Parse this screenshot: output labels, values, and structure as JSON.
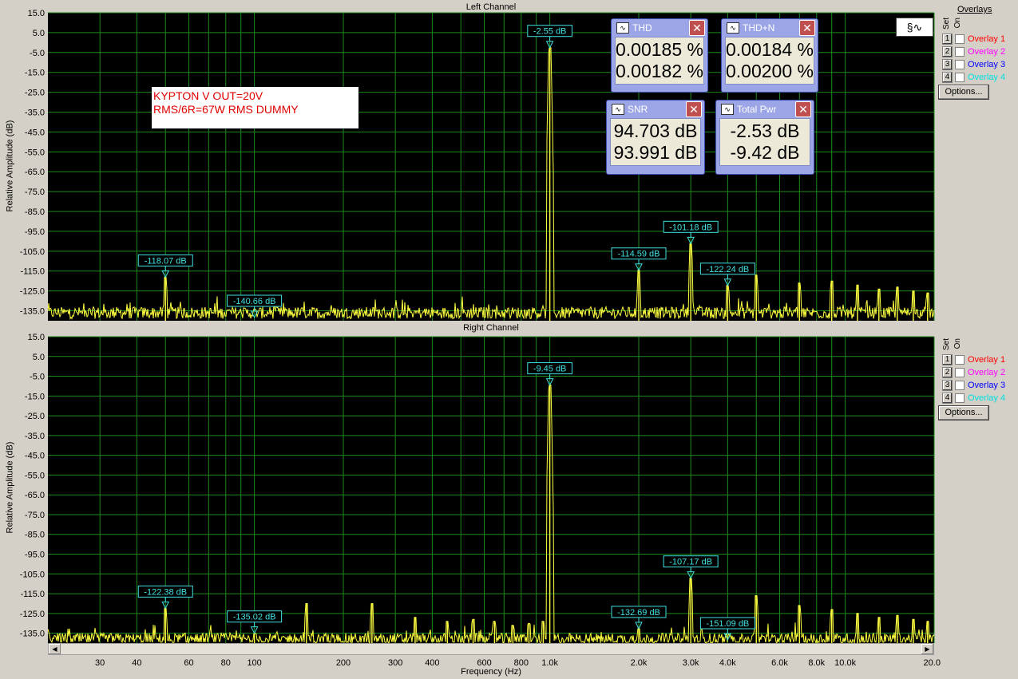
{
  "left_title": "Left Channel",
  "right_title": "Right Channel",
  "ylabel": "Relative Amplitude (dB)",
  "xlabel": "Frequency (Hz)",
  "note_lines": [
    "KYPTON V OUT=20V",
    "RMS/6R=67W RMS DUMMY"
  ],
  "overlays_header": "Overlays",
  "set_label": "Set",
  "on_label": "On",
  "overlays": [
    {
      "num": "1",
      "label": "Overlay 1",
      "color": "#ff0000"
    },
    {
      "num": "2",
      "label": "Overlay 2",
      "color": "#ff00ff"
    },
    {
      "num": "3",
      "label": "Overlay 3",
      "color": "#0000ff"
    },
    {
      "num": "4",
      "label": "Overlay 4",
      "color": "#00ffff"
    }
  ],
  "options_label": "Options...",
  "meters": {
    "thd": {
      "title": "THD",
      "v1": "0.00185 %",
      "v2": "0.00182 %"
    },
    "thdn": {
      "title": "THD+N",
      "v1": "0.00184 %",
      "v2": "0.00200 %"
    },
    "snr": {
      "title": "SNR",
      "v1": "94.703 dB",
      "v2": "93.991 dB"
    },
    "pwr": {
      "title": "Total Pwr",
      "v1": "-2.53 dB",
      "v2": "-9.42 dB"
    }
  },
  "chart_data": [
    {
      "type": "line",
      "title": "Left Channel",
      "xlabel": "Frequency (Hz)",
      "ylabel": "Relative Amplitude (dB)",
      "xscale": "log",
      "xlim": [
        20,
        20000
      ],
      "ylim": [
        -140,
        15
      ],
      "yticks": [
        15,
        5,
        -5,
        -15,
        -25,
        -35,
        -45,
        -55,
        -65,
        -75,
        -85,
        -95,
        -105,
        -115,
        -125,
        -135
      ],
      "ytick_labels": [
        "15.0",
        "5.0",
        "-5.0",
        "-15.0",
        "-25.0",
        "-35.0",
        "-45.0",
        "-55.0",
        "-65.0",
        "-75.0",
        "-85.0",
        "-95.0",
        "-105.0",
        "-115.0",
        "-125.0",
        "-135.0"
      ],
      "grid": true,
      "noise_floor": -136,
      "peaks": [
        {
          "x": 50,
          "y": -118.07
        },
        {
          "x": 100,
          "y": -140.66
        },
        {
          "x": 1000,
          "y": -2.55
        },
        {
          "x": 2000,
          "y": -114.59
        },
        {
          "x": 3000,
          "y": -101.18
        },
        {
          "x": 4000,
          "y": -122.24
        },
        {
          "x": 5000,
          "y": -117
        },
        {
          "x": 7000,
          "y": -121
        },
        {
          "x": 9000,
          "y": -120
        },
        {
          "x": 11000,
          "y": -122
        },
        {
          "x": 13000,
          "y": -124
        },
        {
          "x": 15000,
          "y": -123
        },
        {
          "x": 17000,
          "y": -125
        },
        {
          "x": 19000,
          "y": -126
        }
      ],
      "annotations": [
        {
          "x": 50,
          "y": -118.07,
          "text": "-118.07 dB"
        },
        {
          "x": 100,
          "y": -140.66,
          "text": "-140.66 dB"
        },
        {
          "x": 1000,
          "y": -2.55,
          "text": "-2.55 dB"
        },
        {
          "x": 2000,
          "y": -114.59,
          "text": "-114.59 dB"
        },
        {
          "x": 3000,
          "y": -101.18,
          "text": "-101.18 dB"
        },
        {
          "x": 4000,
          "y": -122.24,
          "text": "-122.24 dB"
        }
      ]
    },
    {
      "type": "line",
      "title": "Right Channel",
      "xlabel": "Frequency (Hz)",
      "ylabel": "Relative Amplitude (dB)",
      "xscale": "log",
      "xlim": [
        20,
        20000
      ],
      "ylim": [
        -140,
        15
      ],
      "yticks": [
        15,
        5,
        -5,
        -15,
        -25,
        -35,
        -45,
        -55,
        -65,
        -75,
        -85,
        -95,
        -105,
        -115,
        -125,
        -135
      ],
      "ytick_labels": [
        "15.0",
        "5.0",
        "-5.0",
        "-15.0",
        "-25.0",
        "-35.0",
        "-45.0",
        "-55.0",
        "-65.0",
        "-75.0",
        "-85.0",
        "-95.0",
        "-105.0",
        "-115.0",
        "-125.0",
        "-135.0"
      ],
      "xticks": [
        30,
        40,
        50,
        60,
        80,
        100,
        200,
        300,
        400,
        500,
        600,
        800,
        1000,
        2000,
        3000,
        4000,
        5000,
        6000,
        8000,
        10000,
        20000
      ],
      "xtick_labels": [
        "30",
        "40",
        "",
        "60",
        "80",
        "100",
        "200",
        "300",
        "400",
        "",
        "600",
        "800",
        "1.0k",
        "2.0k",
        "3.0k",
        "4.0k",
        "",
        "6.0k",
        "8.0k",
        "10.0k",
        "20.0k"
      ],
      "grid": true,
      "noise_floor": -138,
      "peaks": [
        {
          "x": 50,
          "y": -122.38
        },
        {
          "x": 100,
          "y": -135.02
        },
        {
          "x": 150,
          "y": -120
        },
        {
          "x": 250,
          "y": -120
        },
        {
          "x": 350,
          "y": -127
        },
        {
          "x": 450,
          "y": -129
        },
        {
          "x": 550,
          "y": -128
        },
        {
          "x": 650,
          "y": -129
        },
        {
          "x": 750,
          "y": -131
        },
        {
          "x": 850,
          "y": -130
        },
        {
          "x": 950,
          "y": -129
        },
        {
          "x": 1000,
          "y": -9.45
        },
        {
          "x": 2000,
          "y": -132.69
        },
        {
          "x": 3000,
          "y": -107.17
        },
        {
          "x": 4000,
          "y": -151.09
        },
        {
          "x": 5000,
          "y": -116
        },
        {
          "x": 7000,
          "y": -121
        },
        {
          "x": 9000,
          "y": -123
        },
        {
          "x": 11000,
          "y": -125
        },
        {
          "x": 13000,
          "y": -127
        },
        {
          "x": 15000,
          "y": -126
        },
        {
          "x": 17000,
          "y": -128
        },
        {
          "x": 19000,
          "y": -129
        }
      ],
      "annotations": [
        {
          "x": 50,
          "y": -122.38,
          "text": "-122.38 dB"
        },
        {
          "x": 100,
          "y": -135.02,
          "text": "-135.02 dB"
        },
        {
          "x": 1000,
          "y": -9.45,
          "text": "-9.45 dB"
        },
        {
          "x": 2000,
          "y": -132.69,
          "text": "-132.69 dB"
        },
        {
          "x": 3000,
          "y": -107.17,
          "text": "-107.17 dB"
        },
        {
          "x": 4000,
          "y": -151.09,
          "text": "-151.09 dB"
        }
      ]
    }
  ]
}
